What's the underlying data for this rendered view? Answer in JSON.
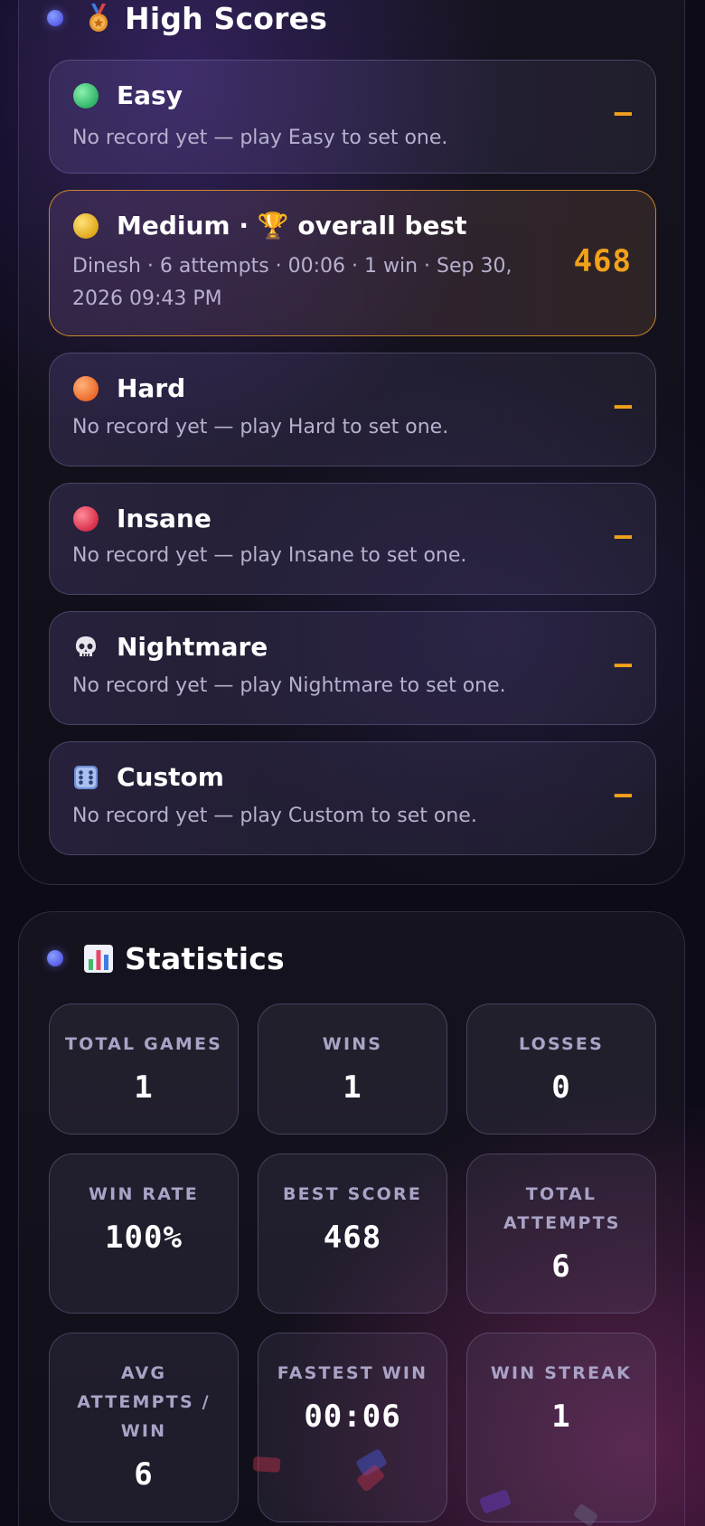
{
  "high_scores": {
    "title": "High Scores",
    "icon": "medal-icon",
    "items": [
      {
        "name": "Easy",
        "icon": "green-circle-icon",
        "color": "#3ecb7a",
        "subtitle": "No record yet — play Easy to set one.",
        "value": "—"
      },
      {
        "name": "Medium · 🏆 overall best",
        "icon": "yellow-circle-icon",
        "color": "#f0c02a",
        "subtitle_line1": "Dinesh · 6 attempts · 00:06 · 1 win · Sep 30,",
        "subtitle_line2": "2026 09:43 PM",
        "value": "468"
      },
      {
        "name": "Hard",
        "icon": "orange-circle-icon",
        "color": "#f58a3a",
        "subtitle": "No record yet — play Hard to set one.",
        "value": "—"
      },
      {
        "name": "Insane",
        "icon": "red-circle-icon",
        "color": "#e8445a",
        "subtitle": "No record yet — play Insane to set one.",
        "value": "—"
      },
      {
        "name": "Nightmare",
        "icon": "skull-icon",
        "subtitle": "No record yet — play Nightmare to set one.",
        "value": "—"
      },
      {
        "name": "Custom",
        "icon": "dice-icon",
        "subtitle": "No record yet — play Custom to set one.",
        "value": "—"
      }
    ]
  },
  "statistics": {
    "title": "Statistics",
    "icon": "bar-chart-icon",
    "tiles": [
      {
        "label": "TOTAL GAMES",
        "value": "1"
      },
      {
        "label": "WINS",
        "value": "1"
      },
      {
        "label": "LOSSES",
        "value": "0"
      },
      {
        "label": "WIN RATE",
        "value": "100%"
      },
      {
        "label": "BEST SCORE",
        "value": "468"
      },
      {
        "label": "TOTAL ATTEMPTS",
        "value": "6"
      },
      {
        "label": "AVG ATTEMPTS / WIN",
        "value": "6"
      },
      {
        "label": "FASTEST WIN",
        "value": "00:06"
      },
      {
        "label": "WIN STREAK",
        "value": "1"
      }
    ]
  },
  "colors": {
    "accent": "#f2a11a",
    "background": "#0d0b16",
    "section_dot": "#6b72f0"
  }
}
